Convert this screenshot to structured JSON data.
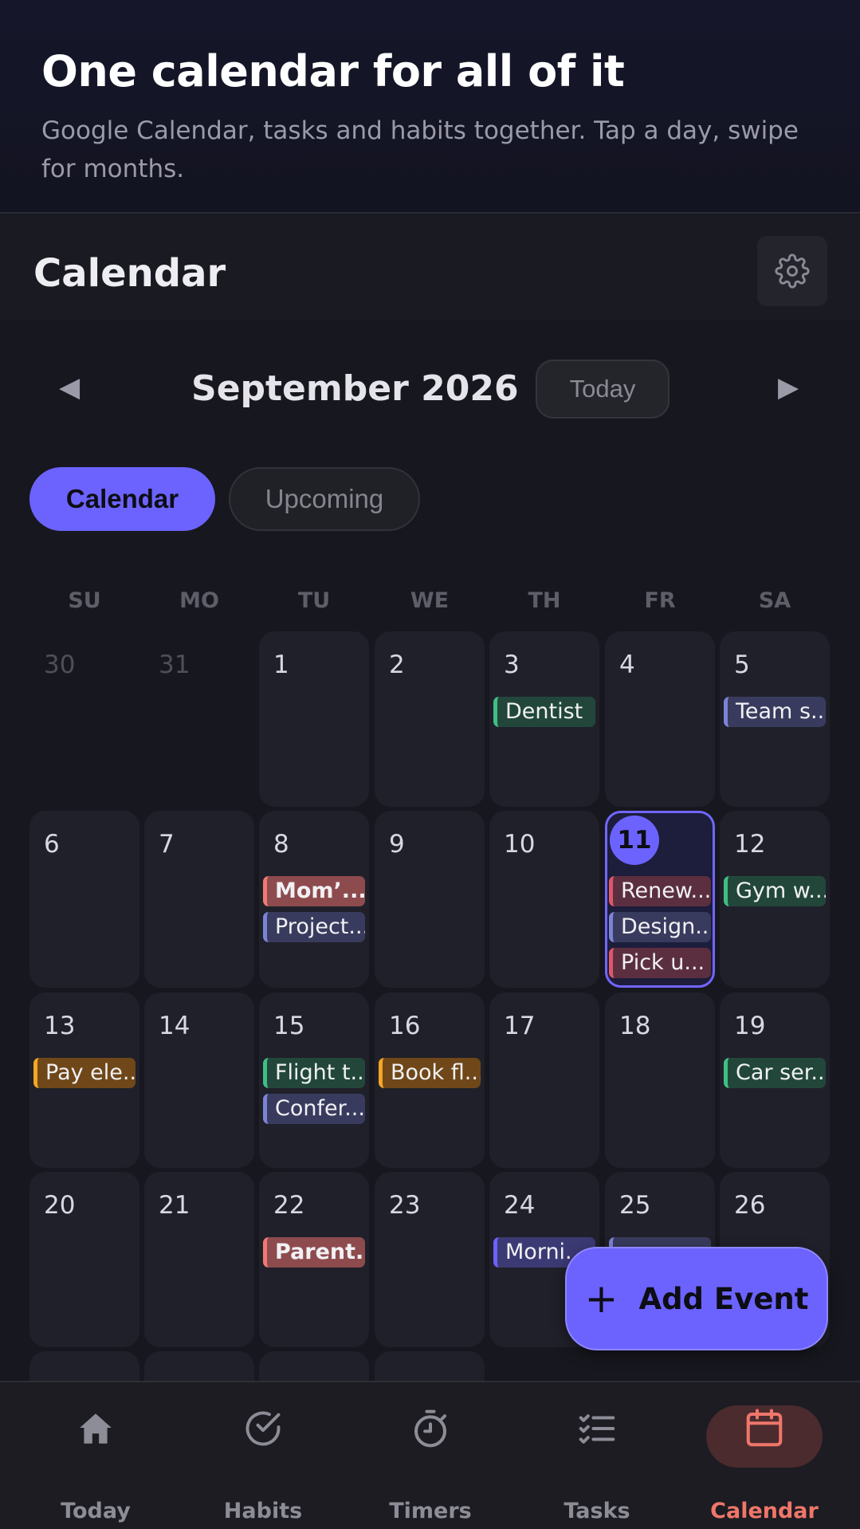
{
  "hero": {
    "title": "One calendar for all of it",
    "subtitle": "Google Calendar, tasks and habits together. Tap a day, swipe for months."
  },
  "header": {
    "title": "Calendar",
    "settings_icon": "gear-icon"
  },
  "month_nav": {
    "prev": "◀",
    "next": "▶",
    "month": "September 2026",
    "today_label": "Today"
  },
  "view_toggle": {
    "calendar": "Calendar",
    "upcoming": "Upcoming",
    "selected": "calendar"
  },
  "weekdays": [
    "SU",
    "MO",
    "TU",
    "WE",
    "TH",
    "FR",
    "SA"
  ],
  "weeks": [
    [
      {
        "day": "30",
        "outside": true,
        "events": []
      },
      {
        "day": "31",
        "outside": true,
        "events": []
      },
      {
        "day": "1",
        "events": []
      },
      {
        "day": "2",
        "events": []
      },
      {
        "day": "3",
        "events": [
          {
            "label": "Dentist",
            "color": "green"
          }
        ]
      },
      {
        "day": "4",
        "events": []
      },
      {
        "day": "5",
        "events": [
          {
            "label": "Team s...",
            "color": "blue"
          }
        ]
      }
    ],
    [
      {
        "day": "6",
        "events": []
      },
      {
        "day": "7",
        "events": []
      },
      {
        "day": "8",
        "events": [
          {
            "label": "Mom’...",
            "color": "red",
            "bold": true
          },
          {
            "label": "Project...",
            "color": "blue"
          }
        ]
      },
      {
        "day": "9",
        "events": []
      },
      {
        "day": "10",
        "events": []
      },
      {
        "day": "11",
        "selected": true,
        "events": [
          {
            "label": "Renew...",
            "color": "maroon"
          },
          {
            "label": "Design...",
            "color": "blue"
          },
          {
            "label": "Pick u...",
            "color": "maroon"
          }
        ]
      },
      {
        "day": "12",
        "events": [
          {
            "label": "Gym w...",
            "color": "green"
          }
        ]
      }
    ],
    [
      {
        "day": "13",
        "events": [
          {
            "label": "Pay ele...",
            "color": "orange"
          }
        ]
      },
      {
        "day": "14",
        "events": []
      },
      {
        "day": "15",
        "events": [
          {
            "label": "Flight t...",
            "color": "green"
          },
          {
            "label": "Confer...",
            "color": "blue"
          }
        ]
      },
      {
        "day": "16",
        "events": [
          {
            "label": "Book fl...",
            "color": "orange"
          }
        ]
      },
      {
        "day": "17",
        "events": []
      },
      {
        "day": "18",
        "events": []
      },
      {
        "day": "19",
        "events": [
          {
            "label": "Car ser...",
            "color": "green"
          }
        ]
      }
    ],
    [
      {
        "day": "20",
        "events": []
      },
      {
        "day": "21",
        "events": []
      },
      {
        "day": "22",
        "events": [
          {
            "label": "Parent...",
            "color": "red",
            "bold": true
          }
        ]
      },
      {
        "day": "23",
        "events": []
      },
      {
        "day": "24",
        "events": [
          {
            "label": "Morni...",
            "color": "purple"
          }
        ]
      },
      {
        "day": "25",
        "events": [
          {
            "label": "",
            "color": "blue"
          }
        ]
      },
      {
        "day": "26",
        "events": []
      }
    ],
    [
      {
        "day": "",
        "events": []
      },
      {
        "day": "",
        "events": []
      },
      {
        "day": "",
        "events": []
      },
      {
        "day": "",
        "events": []
      },
      {
        "day": "",
        "outside": true,
        "events": []
      },
      {
        "day": "",
        "outside": true,
        "events": []
      },
      {
        "day": "",
        "outside": true,
        "events": []
      }
    ]
  ],
  "event_colors": {
    "green": {
      "bg": "#22473a",
      "bar": "#3fbf85"
    },
    "blue": {
      "bg": "#393b5e",
      "bar": "#7b84d6"
    },
    "red": {
      "bg": "#8e4b4e",
      "bar": "#f07a72"
    },
    "maroon": {
      "bg": "#5b2f3f",
      "bar": "#e0566a"
    },
    "orange": {
      "bg": "#6f4718",
      "bar": "#f5a623"
    },
    "purple": {
      "bg": "#3c3a74",
      "bar": "#6c63ff"
    }
  },
  "fab": {
    "icon": "+",
    "label": "Add Event"
  },
  "bottom_nav": [
    {
      "label": "Today",
      "icon": "home-icon"
    },
    {
      "label": "Habits",
      "icon": "check-circle-icon"
    },
    {
      "label": "Timers",
      "icon": "stopwatch-icon"
    },
    {
      "label": "Tasks",
      "icon": "checklist-icon"
    },
    {
      "label": "Calendar",
      "icon": "calendar-icon",
      "active": true
    }
  ],
  "colors": {
    "accent": "#6c63ff",
    "active_nav": "#f0766a",
    "background": "#17171f"
  }
}
